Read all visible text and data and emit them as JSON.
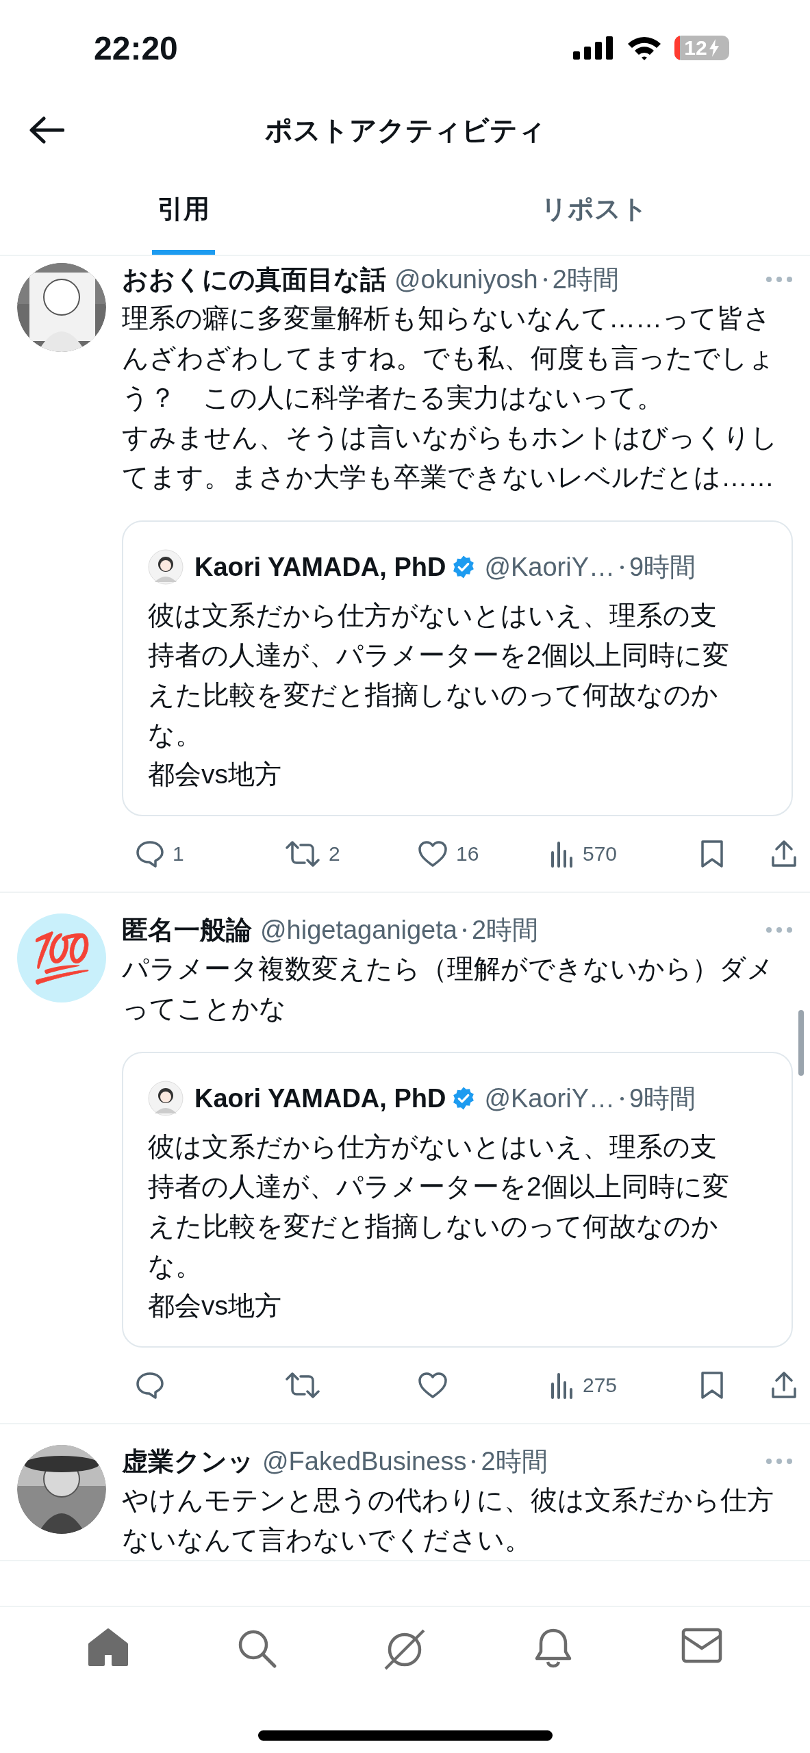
{
  "status_bar": {
    "time": "22:20",
    "battery": "12"
  },
  "header": {
    "title": "ポストアクティビティ"
  },
  "tabs": [
    {
      "label": "引用",
      "selected": true
    },
    {
      "label": "リポスト",
      "selected": false
    }
  ],
  "posts": [
    {
      "avatar": {
        "kind": "picture"
      },
      "name": "おおくにの真面目な話",
      "handle": "@okuniyosh",
      "time": "2時間",
      "body": [
        "理系の癖に多変量解析も知らないなんて……って皆さんざわざわしてますね。でも私、何度も言ったでしょう？　この人に科学者たる実力はないって。",
        "すみません、そうは言いながらもホントはびっくりしてます。まさか大学も卒業できないレベルだとは……"
      ],
      "quote": {
        "name": "Kaori YAMADA, PhD",
        "verified": true,
        "handle": "@KaoriY…",
        "time": "9時間",
        "body": [
          "彼は文系だから仕方がないとはいえ、理系の支持者の人達が、パラメーターを2個以上同時に変えた比較を変だと指摘しないのって何故なのかな。",
          "都会vs地方"
        ]
      },
      "actions": [
        {
          "kind": "reply",
          "count": "1"
        },
        {
          "kind": "repost",
          "count": "2"
        },
        {
          "kind": "like",
          "count": "16"
        },
        {
          "kind": "views",
          "count": "570"
        },
        {
          "kind": "bookmark"
        },
        {
          "kind": "share"
        }
      ]
    },
    {
      "avatar": {
        "kind": "emoji",
        "char": "💯"
      },
      "name": "匿名一般論",
      "handle": "@higetaganigeta",
      "time": "2時間",
      "body": [
        "パラメータ複数変えたら（理解ができないから）ダメってことかな"
      ],
      "quote": {
        "name": "Kaori YAMADA, PhD",
        "verified": true,
        "handle": "@KaoriY…",
        "time": "9時間",
        "body": [
          "彼は文系だから仕方がないとはいえ、理系の支持者の人達が、パラメーターを2個以上同時に変えた比較を変だと指摘しないのって何故なのかな。",
          "都会vs地方"
        ]
      },
      "actions": [
        {
          "kind": "reply"
        },
        {
          "kind": "repost"
        },
        {
          "kind": "like"
        },
        {
          "kind": "views",
          "count": "275"
        },
        {
          "kind": "bookmark"
        },
        {
          "kind": "share"
        }
      ]
    },
    {
      "avatar": {
        "kind": "picture"
      },
      "name": "虚業クンッ",
      "handle": "@FakedBusiness",
      "time": "2時間",
      "body": [
        "やけんモテンと思うの代わりに、彼は文系だから仕方ないなんて言わないでください。"
      ]
    }
  ],
  "bottom_nav": [
    {
      "kind": "home",
      "selected": true
    },
    {
      "kind": "search",
      "selected": false
    },
    {
      "kind": "grok",
      "selected": false
    },
    {
      "kind": "bell",
      "selected": false
    },
    {
      "kind": "mail",
      "selected": false
    }
  ]
}
